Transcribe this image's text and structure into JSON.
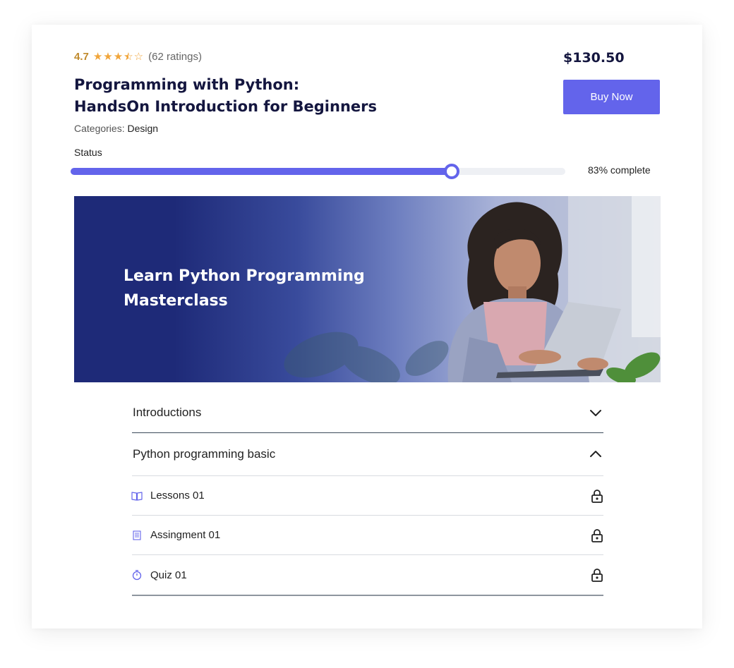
{
  "course": {
    "rating_value": "4.7",
    "stars_full": "★★★",
    "stars_half": "⯪",
    "stars_empty": "☆",
    "rating_count": "(62 ratings)",
    "title_line1": "Programming with Python:",
    "title_line2": "HandsOn Introduction for Beginners",
    "categories_label": "Categories:",
    "categories_value": "Design",
    "price": "$130.50",
    "buy_label": "Buy Now"
  },
  "status": {
    "label": "Status",
    "progress_fraction": 0.77,
    "text": "83% complete"
  },
  "banner": {
    "title_line1": "Learn Python Programming",
    "title_line2": "Masterclass"
  },
  "curriculum": {
    "sections": [
      {
        "title": "Introductions",
        "expanded": false
      },
      {
        "title": "Python programming basic",
        "expanded": true
      }
    ],
    "items": [
      {
        "title": "Lessons 01",
        "icon": "book-icon"
      },
      {
        "title": "Assingment 01",
        "icon": "document-icon"
      },
      {
        "title": "Quiz 01",
        "icon": "stopwatch-icon"
      }
    ]
  },
  "colors": {
    "accent": "#6364eb",
    "title": "#14163f",
    "rating": "#c08a2c",
    "stars": "#f1a53a",
    "banner": "#1e2a78"
  }
}
